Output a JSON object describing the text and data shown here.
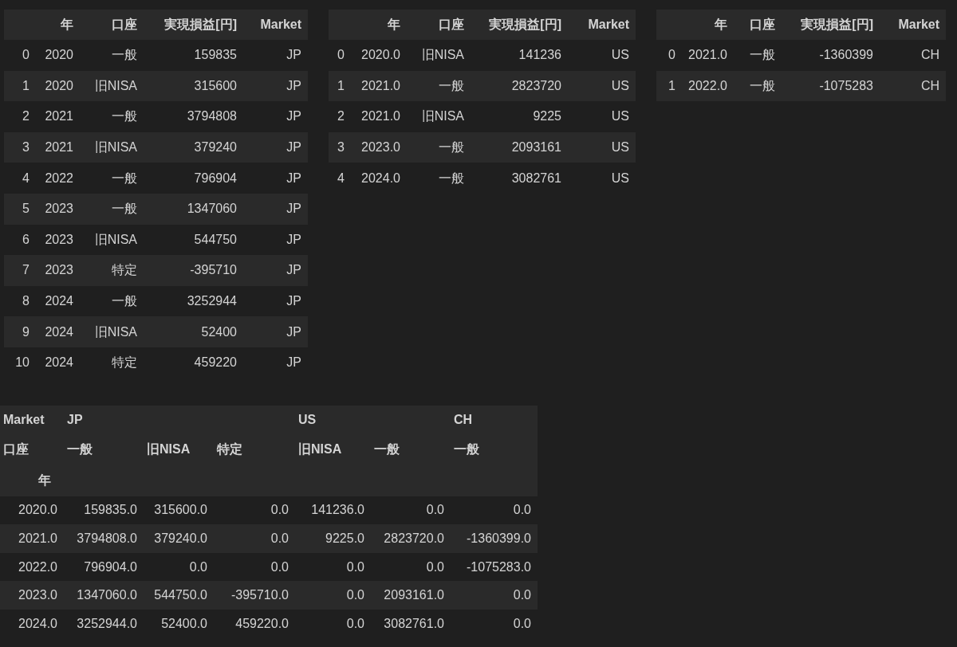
{
  "tables": [
    {
      "columns": [
        "年",
        "口座",
        "実現損益[円]",
        "Market"
      ],
      "rows": [
        {
          "index": "0",
          "cells": [
            "2020",
            "一般",
            "159835",
            "JP"
          ]
        },
        {
          "index": "1",
          "cells": [
            "2020",
            "旧NISA",
            "315600",
            "JP"
          ]
        },
        {
          "index": "2",
          "cells": [
            "2021",
            "一般",
            "3794808",
            "JP"
          ]
        },
        {
          "index": "3",
          "cells": [
            "2021",
            "旧NISA",
            "379240",
            "JP"
          ]
        },
        {
          "index": "4",
          "cells": [
            "2022",
            "一般",
            "796904",
            "JP"
          ]
        },
        {
          "index": "5",
          "cells": [
            "2023",
            "一般",
            "1347060",
            "JP"
          ]
        },
        {
          "index": "6",
          "cells": [
            "2023",
            "旧NISA",
            "544750",
            "JP"
          ]
        },
        {
          "index": "7",
          "cells": [
            "2023",
            "特定",
            "-395710",
            "JP"
          ]
        },
        {
          "index": "8",
          "cells": [
            "2024",
            "一般",
            "3252944",
            "JP"
          ]
        },
        {
          "index": "9",
          "cells": [
            "2024",
            "旧NISA",
            "52400",
            "JP"
          ]
        },
        {
          "index": "10",
          "cells": [
            "2024",
            "特定",
            "459220",
            "JP"
          ]
        }
      ]
    },
    {
      "columns": [
        "年",
        "口座",
        "実現損益[円]",
        "Market"
      ],
      "rows": [
        {
          "index": "0",
          "cells": [
            "2020.0",
            "旧NISA",
            "141236",
            "US"
          ]
        },
        {
          "index": "1",
          "cells": [
            "2021.0",
            "一般",
            "2823720",
            "US"
          ]
        },
        {
          "index": "2",
          "cells": [
            "2021.0",
            "旧NISA",
            "9225",
            "US"
          ]
        },
        {
          "index": "3",
          "cells": [
            "2023.0",
            "一般",
            "2093161",
            "US"
          ]
        },
        {
          "index": "4",
          "cells": [
            "2024.0",
            "一般",
            "3082761",
            "US"
          ]
        }
      ]
    },
    {
      "columns": [
        "年",
        "口座",
        "実現損益[円]",
        "Market"
      ],
      "rows": [
        {
          "index": "0",
          "cells": [
            "2021.0",
            "一般",
            "-1360399",
            "CH"
          ]
        },
        {
          "index": "1",
          "cells": [
            "2022.0",
            "一般",
            "-1075283",
            "CH"
          ]
        }
      ]
    }
  ],
  "pivot": {
    "column_level_names": [
      "Market",
      "口座"
    ],
    "index_name": "年",
    "groups": [
      {
        "label": "JP",
        "columns": [
          "一般",
          "旧NISA",
          "特定"
        ]
      },
      {
        "label": "US",
        "columns": [
          "旧NISA",
          "一般"
        ]
      },
      {
        "label": "CH",
        "columns": [
          "一般"
        ]
      }
    ],
    "rows": [
      {
        "index": "2020.0",
        "cells": [
          "159835.0",
          "315600.0",
          "0.0",
          "141236.0",
          "0.0",
          "0.0"
        ]
      },
      {
        "index": "2021.0",
        "cells": [
          "3794808.0",
          "379240.0",
          "0.0",
          "9225.0",
          "2823720.0",
          "-1360399.0"
        ]
      },
      {
        "index": "2022.0",
        "cells": [
          "796904.0",
          "0.0",
          "0.0",
          "0.0",
          "0.0",
          "-1075283.0"
        ]
      },
      {
        "index": "2023.0",
        "cells": [
          "1347060.0",
          "544750.0",
          "-395710.0",
          "0.0",
          "2093161.0",
          "0.0"
        ]
      },
      {
        "index": "2024.0",
        "cells": [
          "3252944.0",
          "52400.0",
          "459220.0",
          "0.0",
          "3082761.0",
          "0.0"
        ]
      }
    ]
  }
}
